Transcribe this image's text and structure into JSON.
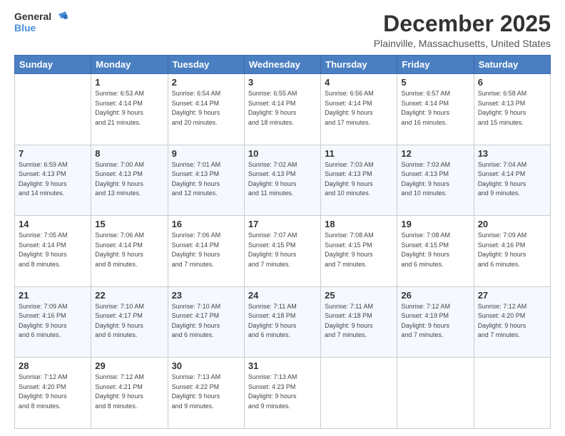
{
  "logo": {
    "line1": "General",
    "line2": "Blue"
  },
  "header": {
    "month": "December 2025",
    "location": "Plainville, Massachusetts, United States"
  },
  "weekdays": [
    "Sunday",
    "Monday",
    "Tuesday",
    "Wednesday",
    "Thursday",
    "Friday",
    "Saturday"
  ],
  "weeks": [
    [
      {
        "day": "",
        "info": ""
      },
      {
        "day": "1",
        "info": "Sunrise: 6:53 AM\nSunset: 4:14 PM\nDaylight: 9 hours\nand 21 minutes."
      },
      {
        "day": "2",
        "info": "Sunrise: 6:54 AM\nSunset: 4:14 PM\nDaylight: 9 hours\nand 20 minutes."
      },
      {
        "day": "3",
        "info": "Sunrise: 6:55 AM\nSunset: 4:14 PM\nDaylight: 9 hours\nand 18 minutes."
      },
      {
        "day": "4",
        "info": "Sunrise: 6:56 AM\nSunset: 4:14 PM\nDaylight: 9 hours\nand 17 minutes."
      },
      {
        "day": "5",
        "info": "Sunrise: 6:57 AM\nSunset: 4:14 PM\nDaylight: 9 hours\nand 16 minutes."
      },
      {
        "day": "6",
        "info": "Sunrise: 6:58 AM\nSunset: 4:13 PM\nDaylight: 9 hours\nand 15 minutes."
      }
    ],
    [
      {
        "day": "7",
        "info": "Sunrise: 6:59 AM\nSunset: 4:13 PM\nDaylight: 9 hours\nand 14 minutes."
      },
      {
        "day": "8",
        "info": "Sunrise: 7:00 AM\nSunset: 4:13 PM\nDaylight: 9 hours\nand 13 minutes."
      },
      {
        "day": "9",
        "info": "Sunrise: 7:01 AM\nSunset: 4:13 PM\nDaylight: 9 hours\nand 12 minutes."
      },
      {
        "day": "10",
        "info": "Sunrise: 7:02 AM\nSunset: 4:13 PM\nDaylight: 9 hours\nand 11 minutes."
      },
      {
        "day": "11",
        "info": "Sunrise: 7:03 AM\nSunset: 4:13 PM\nDaylight: 9 hours\nand 10 minutes."
      },
      {
        "day": "12",
        "info": "Sunrise: 7:03 AM\nSunset: 4:13 PM\nDaylight: 9 hours\nand 10 minutes."
      },
      {
        "day": "13",
        "info": "Sunrise: 7:04 AM\nSunset: 4:14 PM\nDaylight: 9 hours\nand 9 minutes."
      }
    ],
    [
      {
        "day": "14",
        "info": "Sunrise: 7:05 AM\nSunset: 4:14 PM\nDaylight: 9 hours\nand 8 minutes."
      },
      {
        "day": "15",
        "info": "Sunrise: 7:06 AM\nSunset: 4:14 PM\nDaylight: 9 hours\nand 8 minutes."
      },
      {
        "day": "16",
        "info": "Sunrise: 7:06 AM\nSunset: 4:14 PM\nDaylight: 9 hours\nand 7 minutes."
      },
      {
        "day": "17",
        "info": "Sunrise: 7:07 AM\nSunset: 4:15 PM\nDaylight: 9 hours\nand 7 minutes."
      },
      {
        "day": "18",
        "info": "Sunrise: 7:08 AM\nSunset: 4:15 PM\nDaylight: 9 hours\nand 7 minutes."
      },
      {
        "day": "19",
        "info": "Sunrise: 7:08 AM\nSunset: 4:15 PM\nDaylight: 9 hours\nand 6 minutes."
      },
      {
        "day": "20",
        "info": "Sunrise: 7:09 AM\nSunset: 4:16 PM\nDaylight: 9 hours\nand 6 minutes."
      }
    ],
    [
      {
        "day": "21",
        "info": "Sunrise: 7:09 AM\nSunset: 4:16 PM\nDaylight: 9 hours\nand 6 minutes."
      },
      {
        "day": "22",
        "info": "Sunrise: 7:10 AM\nSunset: 4:17 PM\nDaylight: 9 hours\nand 6 minutes."
      },
      {
        "day": "23",
        "info": "Sunrise: 7:10 AM\nSunset: 4:17 PM\nDaylight: 9 hours\nand 6 minutes."
      },
      {
        "day": "24",
        "info": "Sunrise: 7:11 AM\nSunset: 4:18 PM\nDaylight: 9 hours\nand 6 minutes."
      },
      {
        "day": "25",
        "info": "Sunrise: 7:11 AM\nSunset: 4:18 PM\nDaylight: 9 hours\nand 7 minutes."
      },
      {
        "day": "26",
        "info": "Sunrise: 7:12 AM\nSunset: 4:19 PM\nDaylight: 9 hours\nand 7 minutes."
      },
      {
        "day": "27",
        "info": "Sunrise: 7:12 AM\nSunset: 4:20 PM\nDaylight: 9 hours\nand 7 minutes."
      }
    ],
    [
      {
        "day": "28",
        "info": "Sunrise: 7:12 AM\nSunset: 4:20 PM\nDaylight: 9 hours\nand 8 minutes."
      },
      {
        "day": "29",
        "info": "Sunrise: 7:12 AM\nSunset: 4:21 PM\nDaylight: 9 hours\nand 8 minutes."
      },
      {
        "day": "30",
        "info": "Sunrise: 7:13 AM\nSunset: 4:22 PM\nDaylight: 9 hours\nand 9 minutes."
      },
      {
        "day": "31",
        "info": "Sunrise: 7:13 AM\nSunset: 4:23 PM\nDaylight: 9 hours\nand 9 minutes."
      },
      {
        "day": "",
        "info": ""
      },
      {
        "day": "",
        "info": ""
      },
      {
        "day": "",
        "info": ""
      }
    ]
  ]
}
